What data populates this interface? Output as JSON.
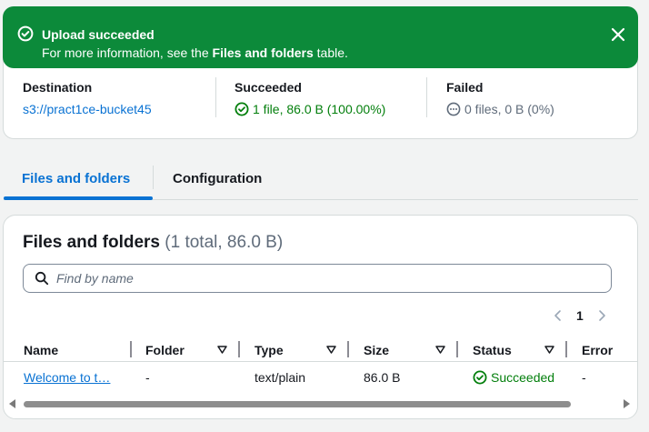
{
  "flash": {
    "title": "Upload succeeded",
    "message_prefix": "For more information, see the ",
    "message_bold": "Files and folders",
    "message_suffix": " table.",
    "icons": {
      "status": "check-circle-icon",
      "close": "close-icon"
    }
  },
  "summary": {
    "destination": {
      "label": "Destination",
      "value": "s3://pract1ce-bucket45"
    },
    "succeeded": {
      "label": "Succeeded",
      "value": "1 file, 86.0 B (100.00%)"
    },
    "failed": {
      "label": "Failed",
      "value": "0 files, 0 B (0%)"
    }
  },
  "tabs": [
    {
      "label": "Files and folders",
      "active": true
    },
    {
      "label": "Configuration",
      "active": false
    }
  ],
  "table": {
    "title": "Files and folders",
    "count": "(1 total, 86.0 B)",
    "search_placeholder": "Find by name",
    "page": "1",
    "columns": [
      "Name",
      "Folder",
      "Type",
      "Size",
      "Status",
      "Error"
    ],
    "rows": [
      {
        "name": "Welcome to t…",
        "folder": "-",
        "type": "text/plain",
        "size": "86.0 B",
        "status": "Succeeded",
        "error": "-"
      }
    ]
  },
  "colors": {
    "success_banner": "#0c8a3a",
    "link": "#0972d3",
    "success_text": "#037f0c"
  }
}
